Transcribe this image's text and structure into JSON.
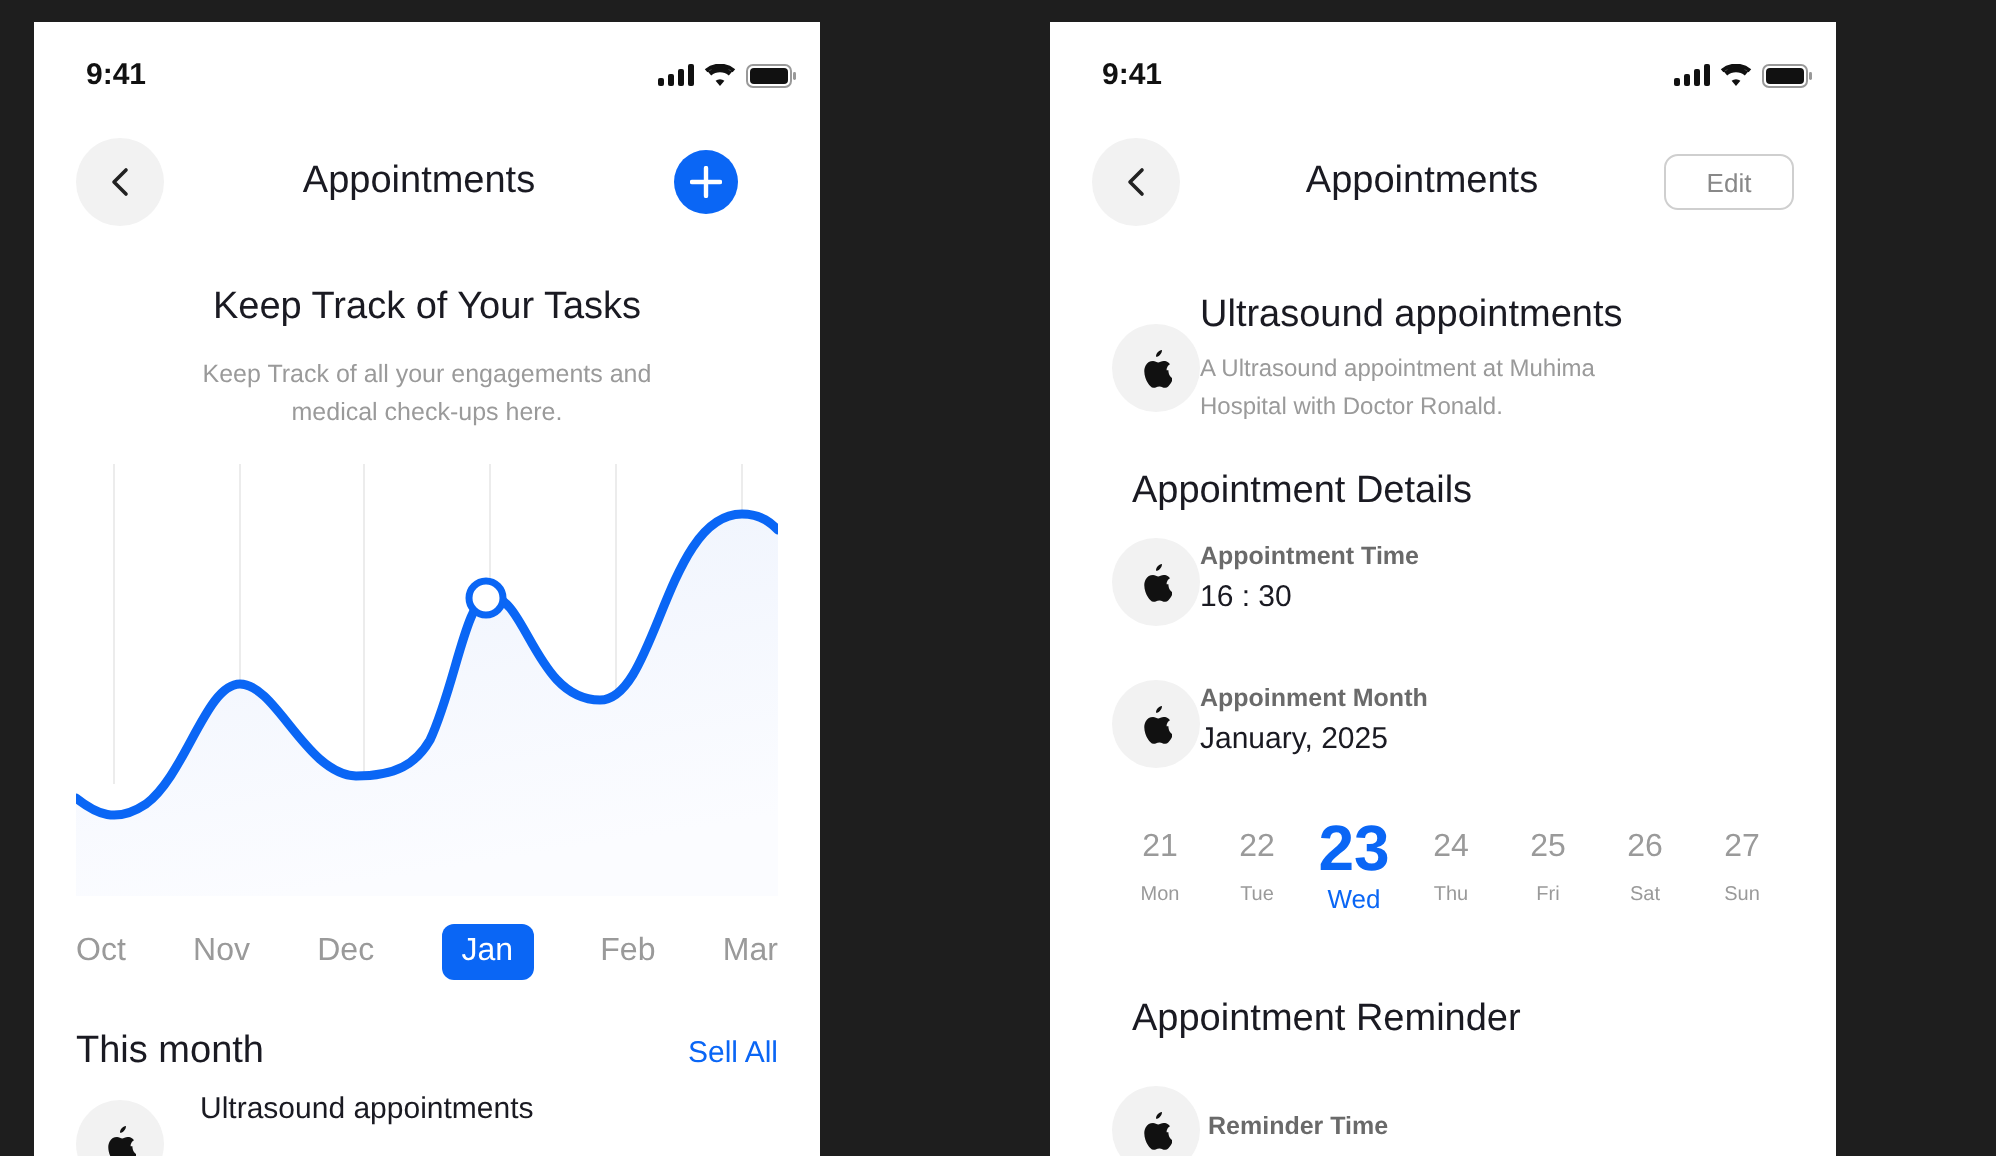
{
  "list_screen": {
    "status_bar": {
      "time": "9:41"
    },
    "header": {
      "title": "Appointments",
      "action": {
        "kind": "add"
      }
    },
    "intro": {
      "title": "Keep Track of Your Tasks",
      "text": "Keep Track of all your engagements and medical check-ups here."
    },
    "months": [
      {
        "label": "Oct",
        "selected": false
      },
      {
        "label": "Nov",
        "selected": false
      },
      {
        "label": "Dec",
        "selected": false
      },
      {
        "label": "Jan",
        "selected": true
      },
      {
        "label": "Feb",
        "selected": false
      },
      {
        "label": "Mar",
        "selected": false
      }
    ],
    "section": {
      "title": "This month",
      "link": "Sell All"
    },
    "appointments": [
      {
        "title": "Ultrasound appointments"
      }
    ]
  },
  "detail_screen": {
    "status_bar": {
      "time": "9:41"
    },
    "header": {
      "title": "Appointments",
      "action": {
        "kind": "edit",
        "label": "Edit"
      }
    },
    "appointment": {
      "title": "Ultrasound appointments",
      "description": "A Ultrasound appointment at Muhima Hospital with Doctor Ronald."
    },
    "details_title": "Appointment Details",
    "details": [
      {
        "label": "Appointment Time",
        "value": "16 : 30"
      },
      {
        "label": "Appoinment Month",
        "value": "January, 2025"
      }
    ],
    "days": [
      {
        "number": "21",
        "day": "Mon",
        "selected": false
      },
      {
        "number": "22",
        "day": "Tue",
        "selected": false
      },
      {
        "number": "23",
        "day": "Wed",
        "selected": true
      },
      {
        "number": "24",
        "day": "Thu",
        "selected": false
      },
      {
        "number": "25",
        "day": "Fri",
        "selected": false
      },
      {
        "number": "26",
        "day": "Sat",
        "selected": false
      },
      {
        "number": "27",
        "day": "Sun",
        "selected": false
      }
    ],
    "reminder_title": "Appointment Reminder",
    "reminders": [
      {
        "label": "Reminder Time"
      }
    ]
  }
}
